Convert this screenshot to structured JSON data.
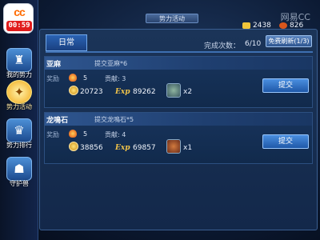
{
  "recorder": {
    "brand": "cc",
    "time": "00:59"
  },
  "watermark": "网易CC",
  "header": {
    "title": "势力活动"
  },
  "resources": [
    {
      "icon": "gold-ingot-icon",
      "value": "2438"
    },
    {
      "icon": "fire-gem-icon",
      "value": "826"
    }
  ],
  "sidebar": {
    "items": [
      {
        "label": "我的势力",
        "icon": "castle-icon",
        "active": false
      },
      {
        "label": "势力活动",
        "icon": "activity-icon",
        "active": true
      },
      {
        "label": "势力排行",
        "icon": "ranking-icon",
        "active": false
      },
      {
        "label": "守护兽",
        "icon": "guardian-beast-icon",
        "active": false
      }
    ]
  },
  "tabs": {
    "daily": "日常"
  },
  "completion": {
    "label": "完成次数：",
    "value": "6/10"
  },
  "refresh_button": "免费刷新(1/3)",
  "quests": [
    {
      "name": "亚麻",
      "objective": "提交亚麻*6",
      "reward_label": "奖励",
      "reward_count": "5",
      "contribution": "贡献: 3",
      "money": "20723",
      "exp_label": "Exp",
      "exp": "89262",
      "item_qty": "x2",
      "submit": "提交"
    },
    {
      "name": "龙鳴石",
      "objective": "提交龙鳴石*5",
      "reward_label": "奖励",
      "reward_count": "5",
      "contribution": "贡献: 4",
      "money": "38856",
      "exp_label": "Exp",
      "exp": "69857",
      "item_qty": "x1",
      "submit": "提交"
    }
  ],
  "colors": {
    "accent": "#2a63b4",
    "gold": "#f2c44a"
  }
}
